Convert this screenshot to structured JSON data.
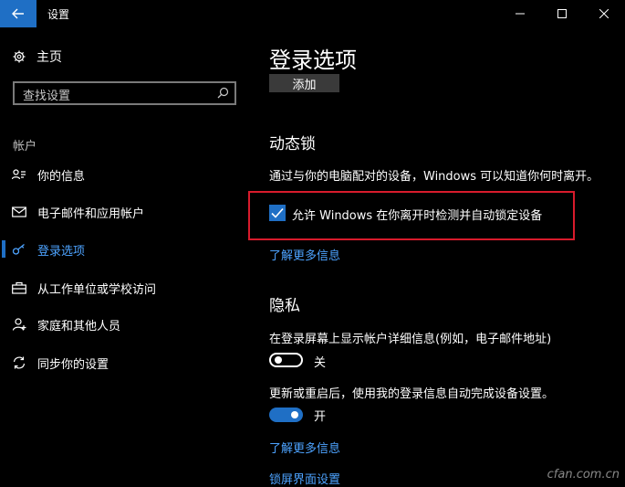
{
  "window": {
    "title": "设置"
  },
  "sidebar": {
    "home_label": "主页",
    "search_placeholder": "查找设置",
    "section_label": "帐户",
    "items": [
      {
        "label": "你的信息",
        "icon": "person-card-icon"
      },
      {
        "label": "电子邮件和应用帐户",
        "icon": "mail-icon"
      },
      {
        "label": "登录选项",
        "icon": "key-icon",
        "active": true
      },
      {
        "label": "从工作单位或学校访问",
        "icon": "briefcase-icon"
      },
      {
        "label": "家庭和其他人员",
        "icon": "person-icon"
      },
      {
        "label": "同步你的设置",
        "icon": "sync-icon"
      }
    ]
  },
  "main": {
    "title": "登录选项",
    "add_button": "添加",
    "dynamic_lock": {
      "heading": "动态锁",
      "description": "通过与你的电脑配对的设备，Windows 可以知道你何时离开。",
      "checkbox_label": "允许 Windows 在你离开时检测并自动锁定设备",
      "checkbox_checked": true,
      "learn_more": "了解更多信息"
    },
    "privacy": {
      "heading": "隐私",
      "setting1_label": "在登录屏幕上显示帐户详细信息(例如，电子邮件地址)",
      "setting1_state": "关",
      "setting2_label": "更新或重启后，使用我的登录信息自动完成设备设置。",
      "setting2_state": "开",
      "learn_more": "了解更多信息",
      "lock_screen_link": "锁屏界面设置"
    }
  },
  "watermark": "cfan.com.cn",
  "colors": {
    "accent": "#1f6fc5",
    "link": "#4da3ff",
    "highlight_border": "#d81b2c"
  }
}
